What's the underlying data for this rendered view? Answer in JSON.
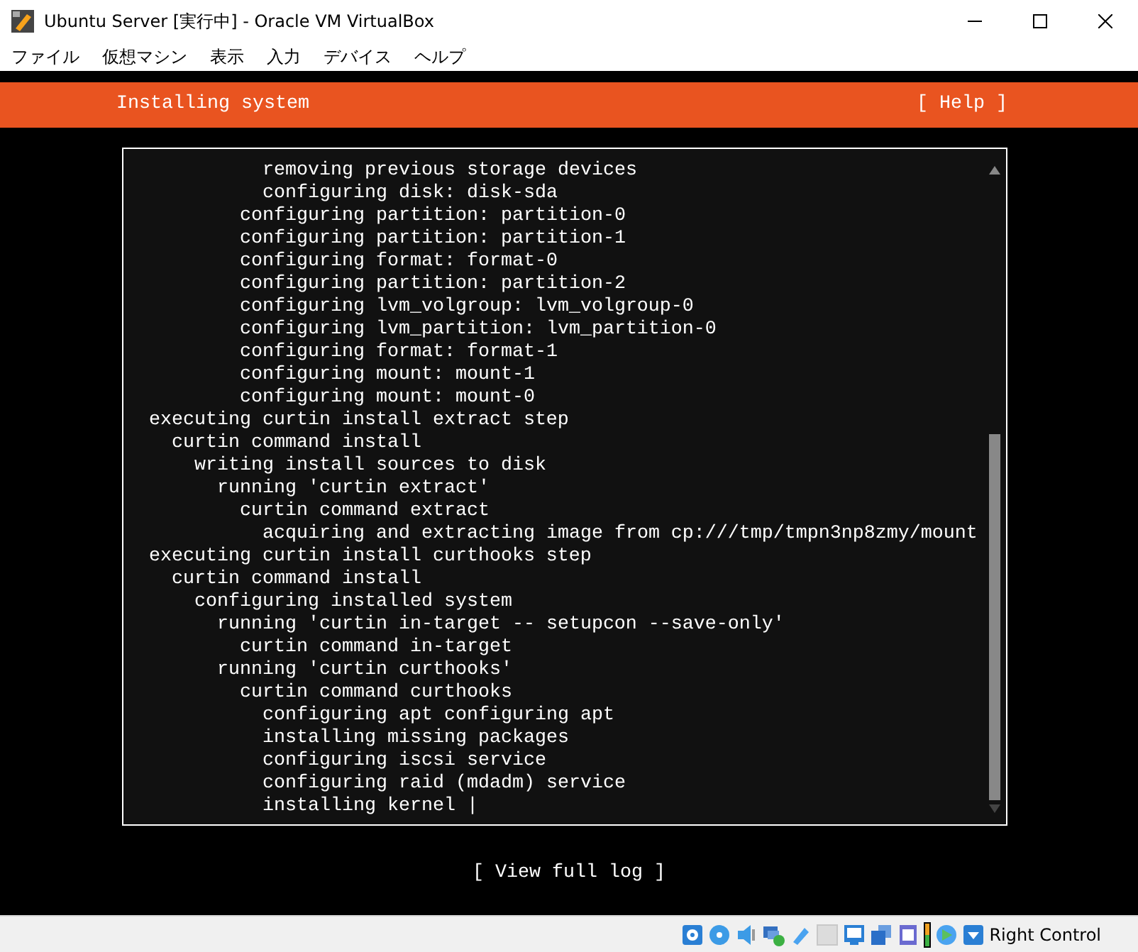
{
  "window": {
    "title": "Ubuntu Server [実行中] - Oracle VM VirtualBox"
  },
  "menu": [
    "ファイル",
    "仮想マシン",
    "表示",
    "入力",
    "デバイス",
    "ヘルプ"
  ],
  "header": {
    "title": "Installing system",
    "help": "[ Help ]"
  },
  "log": [
    {
      "children": [
        {
          "children": [
            {
              "children": [
                {
                  "children": [
                    {
                      "children": [
                        {
                          "text": "removing previous storage devices"
                        },
                        {
                          "text": "configuring disk: disk-sda"
                        }
                      ]
                    },
                    {
                      "text": "configuring partition: partition-0"
                    },
                    {
                      "text": "configuring partition: partition-1"
                    },
                    {
                      "text": "configuring format: format-0"
                    },
                    {
                      "text": "configuring partition: partition-2"
                    },
                    {
                      "text": "configuring lvm_volgroup: lvm_volgroup-0"
                    },
                    {
                      "text": "configuring lvm_partition: lvm_partition-0"
                    },
                    {
                      "text": "configuring format: format-1"
                    },
                    {
                      "text": "configuring mount: mount-1"
                    },
                    {
                      "text": "configuring mount: mount-0"
                    }
                  ]
                }
              ]
            }
          ]
        }
      ]
    },
    {
      "text": "executing curtin install extract step",
      "children": [
        {
          "text": "curtin command install",
          "children": [
            {
              "text": "writing install sources to disk",
              "children": [
                {
                  "text": "running 'curtin extract'",
                  "children": [
                    {
                      "text": "curtin command extract",
                      "children": [
                        {
                          "text": "acquiring and extracting image from cp:///tmp/tmpn3np8zmy/mount"
                        }
                      ]
                    }
                  ]
                }
              ]
            }
          ]
        }
      ]
    },
    {
      "text": "executing curtin install curthooks step",
      "children": [
        {
          "text": "curtin command install",
          "children": [
            {
              "text": "configuring installed system",
              "children": [
                {
                  "text": "running 'curtin in-target -- setupcon --save-only'",
                  "children": [
                    {
                      "text": "curtin command in-target"
                    }
                  ]
                },
                {
                  "text": "running 'curtin curthooks'",
                  "children": [
                    {
                      "text": "curtin command curthooks",
                      "children": [
                        {
                          "text": "configuring apt configuring apt"
                        },
                        {
                          "text": "installing missing packages"
                        },
                        {
                          "text": "configuring iscsi service"
                        },
                        {
                          "text": "configuring raid (mdadm) service"
                        },
                        {
                          "text": "installing kernel |"
                        }
                      ]
                    }
                  ]
                }
              ]
            }
          ]
        }
      ]
    }
  ],
  "view_log_button": "[ View full log ]",
  "status_bar": {
    "host_key": "Right Control"
  }
}
